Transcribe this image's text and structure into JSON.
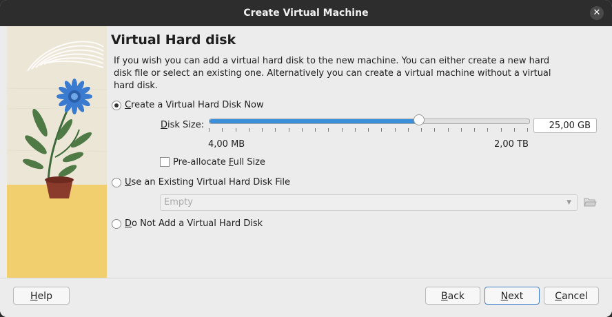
{
  "window": {
    "title": "Create Virtual Machine",
    "close_glyph": "✕"
  },
  "page": {
    "heading": "Virtual Hard disk",
    "description": "If you wish you can add a virtual hard disk to the new machine. You can either create a new hard disk file or select an existing one. Alternatively you can create a virtual machine without a virtual hard disk."
  },
  "options": {
    "create_new": {
      "prefix": "",
      "mnemonic": "C",
      "rest": "reate a Virtual Hard Disk Now",
      "checked": true
    },
    "use_existing": {
      "prefix": "",
      "mnemonic": "U",
      "rest": "se an Existing Virtual Hard Disk File",
      "checked": false
    },
    "do_not_add": {
      "prefix": "",
      "mnemonic": "D",
      "rest": "o Not Add a Virtual Hard Disk",
      "checked": false
    }
  },
  "disk_size": {
    "label_mnemonic": "D",
    "label_rest": "isk Size:",
    "value": "25,00 GB",
    "min_label": "4,00 MB",
    "max_label": "2,00 TB",
    "slider_fraction": 0.655
  },
  "preallocate": {
    "prefix": "Pre-allocate ",
    "mnemonic": "F",
    "rest": "ull Size",
    "checked": false
  },
  "existing_disk": {
    "value": "Empty",
    "enabled": false,
    "folder_icon": "folder-open-icon"
  },
  "buttons": {
    "help": {
      "mnemonic": "H",
      "rest": "elp"
    },
    "back": {
      "mnemonic": "B",
      "rest": "ack"
    },
    "next": {
      "mnemonic": "N",
      "rest": "ext"
    },
    "cancel": {
      "mnemonic": "C",
      "rest": "ancel"
    }
  },
  "colors": {
    "accent": "#3b8ed8",
    "titlebar": "#2d2d2d",
    "side_sand": "#f1cf6e",
    "side_paper": "#ece6d6"
  }
}
